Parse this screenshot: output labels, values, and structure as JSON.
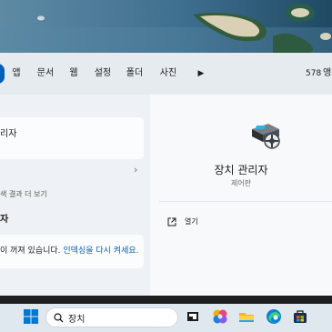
{
  "filters": {
    "chips": [
      "앱",
      "문서",
      "웹",
      "설정",
      "폴더",
      "사진"
    ],
    "count": "578",
    "count_glyph": "앵"
  },
  "results": {
    "best_match_title": "리자",
    "sub_header": "색 결과 더 보기",
    "second_item": "자",
    "notice_prefix": "이 꺼져 있습니다. ",
    "notice_link": "인덱싱을 다시 켜세요."
  },
  "preview": {
    "app_name": "장치 관리자",
    "app_type": "제어판",
    "open_label": "열기"
  },
  "taskbar": {
    "search_value": "장치"
  },
  "colors": {
    "accent": "#005fb8"
  }
}
